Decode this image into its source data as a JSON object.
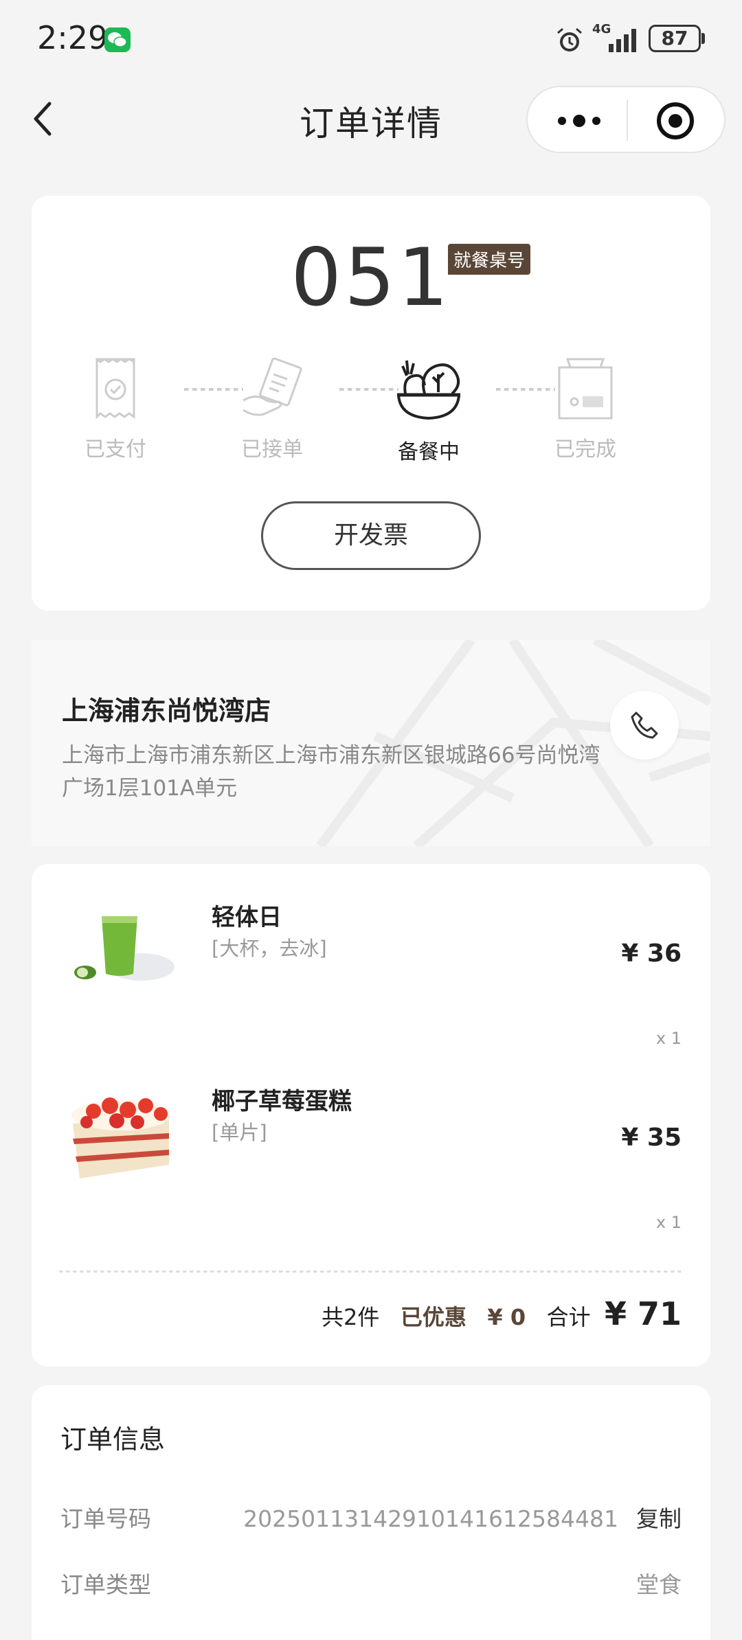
{
  "status_bar": {
    "time": "2:29",
    "network": "4G",
    "battery": "87"
  },
  "nav": {
    "title": "订单详情"
  },
  "order_status": {
    "table_number": "051",
    "table_badge": "就餐桌号",
    "steps": [
      {
        "label": "已支付",
        "icon": "receipt-check-icon",
        "active": false
      },
      {
        "label": "已接单",
        "icon": "hand-receipt-icon",
        "active": false
      },
      {
        "label": "备餐中",
        "icon": "salad-bowl-icon",
        "active": true
      },
      {
        "label": "已完成",
        "icon": "shopping-bag-icon",
        "active": false
      }
    ],
    "invoice_button": "开发票"
  },
  "store": {
    "name": "上海浦东尚悦湾店",
    "address": "上海市上海市浦东新区上海市浦东新区银城路66号尚悦湾广场1层101A单元"
  },
  "items": [
    {
      "name": "轻体日",
      "spec": "[大杯，去冰]",
      "price": "¥ 36",
      "qty": "x 1"
    },
    {
      "name": "椰子草莓蛋糕",
      "spec": "[单片]",
      "price": "¥ 35",
      "qty": "x 1"
    }
  ],
  "summary": {
    "count": "共2件",
    "discount_label": "已优惠",
    "discount_value": "¥ 0",
    "total_label": "合计",
    "total_value": "¥ 71"
  },
  "order_info": {
    "title": "订单信息",
    "rows": [
      {
        "label": "订单号码",
        "value": "20250113142910141612584481",
        "action": "复制"
      },
      {
        "label": "订单类型",
        "value": "堂食"
      }
    ]
  },
  "colors": {
    "accent_brown": "#5a4637",
    "background": "#f4f4f4"
  }
}
